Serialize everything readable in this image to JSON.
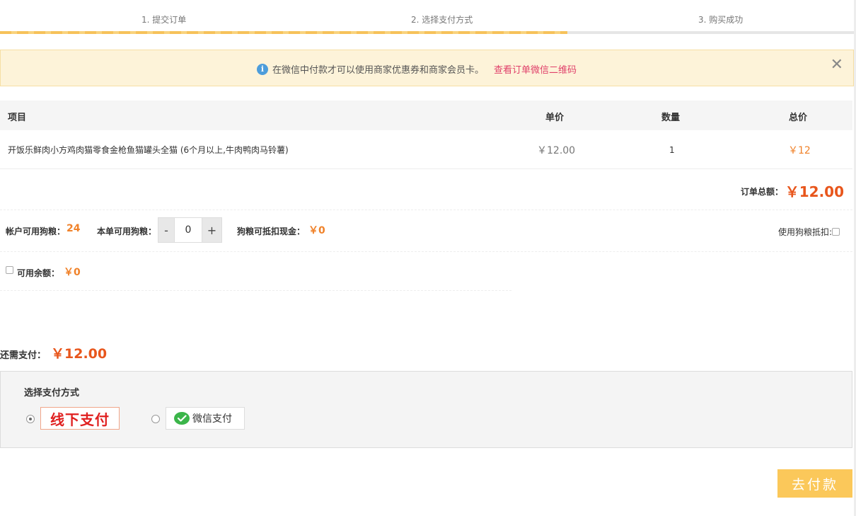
{
  "steps": {
    "step1": "1. 提交订单",
    "step2": "2. 选择支付方式",
    "step3": "3. 购买成功"
  },
  "notice": {
    "text": "在微信中付款才可以使用商家优惠券和商家会员卡。",
    "link": "查看订单微信二维码",
    "icon": "info-icon",
    "close_icon": "close-icon"
  },
  "table": {
    "headers": {
      "item": "项目",
      "price": "单价",
      "qty": "数量",
      "total": "总价"
    },
    "rows": [
      {
        "item": "开饭乐鲜肉小方鸡肉猫零食金枪鱼猫罐头全猫 (6个月以上,牛肉鸭肉马铃薯)",
        "price": "￥12.00",
        "qty": "1",
        "total": "￥12"
      }
    ]
  },
  "order_total": {
    "label": "订单总额：",
    "value": "￥12.00"
  },
  "dog_food": {
    "account_label": "帐户可用狗粮：",
    "account_value": "24",
    "usable_label": "本单可用狗粮：",
    "minus": "-",
    "quantity": "0",
    "plus": "+",
    "cash_label": "狗粮可抵扣现金：",
    "cash_value": "￥0",
    "toggle_label": "使用狗粮抵扣:"
  },
  "balance": {
    "label": "可用余额：",
    "value": "￥0"
  },
  "amount_due": {
    "label": "还需支付：",
    "value": "￥12.00"
  },
  "payment": {
    "title": "选择支付方式",
    "offline_label": "线下支付",
    "wechat_label": "微信支付",
    "selected": "offline"
  },
  "pay_button": "去付款",
  "colors": {
    "accent_orange": "#e8561c",
    "link_pink": "#e0406a",
    "button_yellow": "#fbc85a",
    "notice_bg": "#fdf3d9"
  }
}
